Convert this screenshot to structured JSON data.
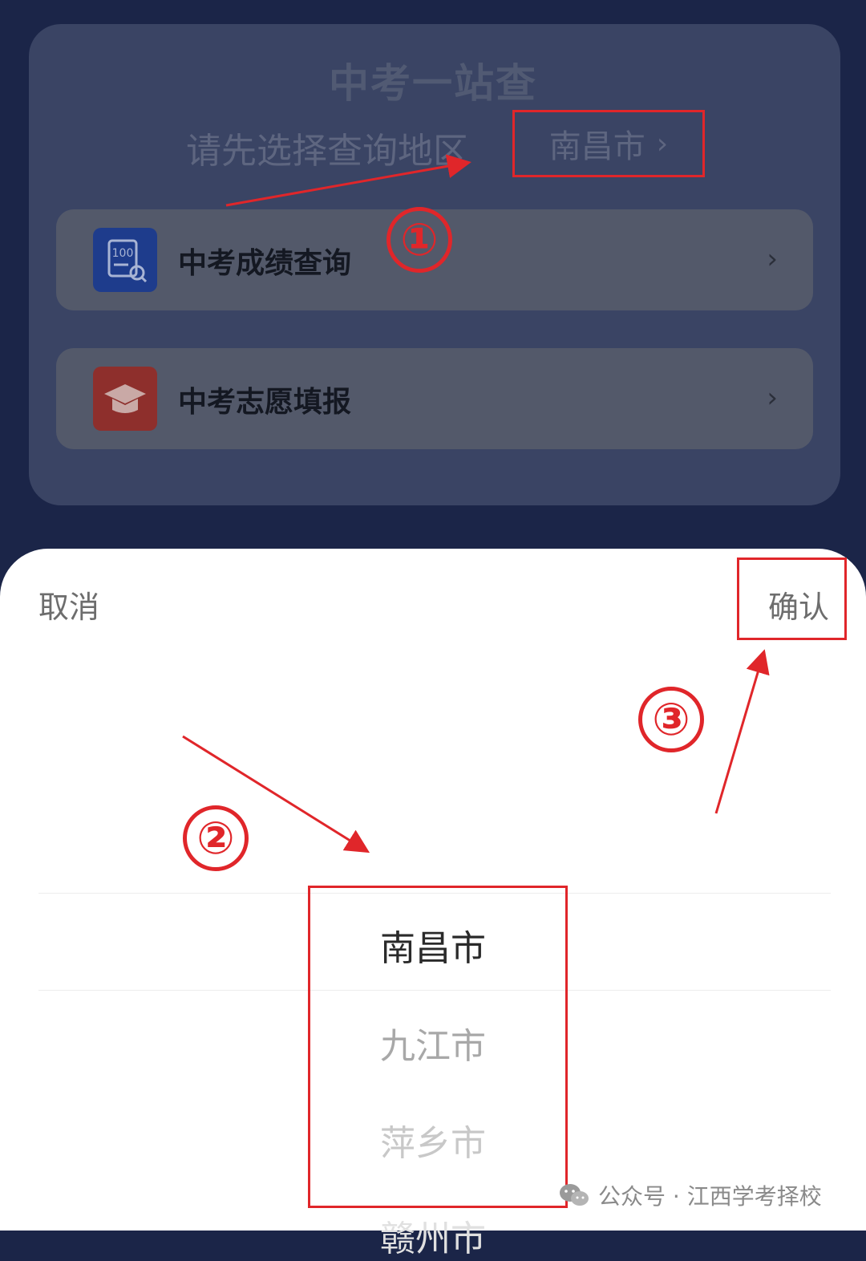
{
  "page": {
    "title": "中考一站查",
    "region_prompt": "请先选择查询地区",
    "region_value": "南昌市",
    "region_chevron": "›"
  },
  "menu": [
    {
      "label": "中考成绩查询",
      "icon": "score-report-icon",
      "icon_color": "#1e3c8c"
    },
    {
      "label": "中考志愿填报",
      "icon": "graduation-cap-icon",
      "icon_color": "#8e2f2c"
    }
  ],
  "menu_chevron": "›",
  "sheet": {
    "cancel_label": "取消",
    "confirm_label": "确认",
    "options": [
      "南昌市",
      "九江市",
      "萍乡市",
      "赣州市"
    ],
    "selected": "南昌市"
  },
  "annotations": {
    "steps": [
      "①",
      "②",
      "③"
    ],
    "color": "#e0262a"
  },
  "watermark": {
    "text": "公众号 · 江西学考择校"
  }
}
